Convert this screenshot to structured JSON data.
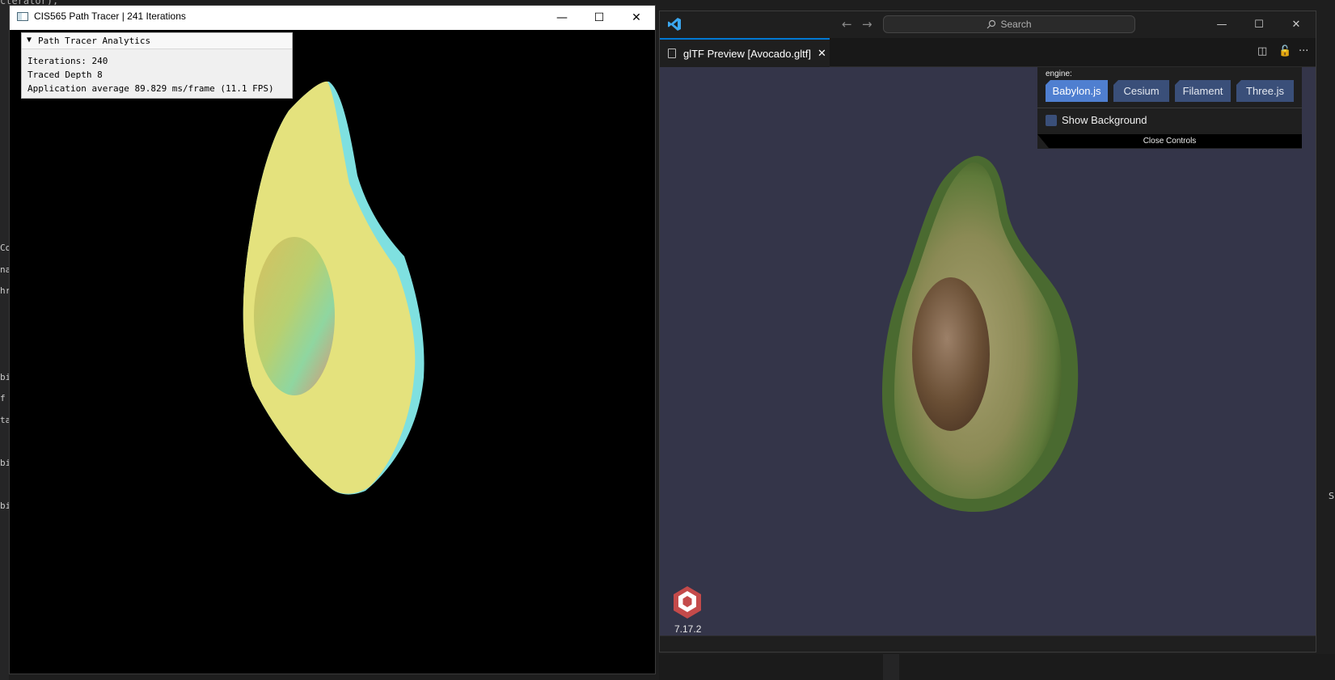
{
  "background_editor": {
    "top_line": "cterator);",
    "fragments": [
      "Co",
      "nal",
      "hr",
      "bi",
      "f",
      "ta",
      "bi",
      "bi"
    ],
    "right_fragment": "S"
  },
  "path_tracer": {
    "title": "CIS565 Path Tracer | 241 Iterations",
    "controls": {
      "minimize": "—",
      "maximize": "☐",
      "close": "✕"
    },
    "analytics": {
      "arrow": "▼",
      "title": "Path Tracer Analytics",
      "iterations": "Iterations: 240",
      "traced_depth": "Traced Depth 8",
      "average": "Application average 89.829 ms/frame (11.1 FPS)"
    }
  },
  "vscode": {
    "nav_back": "←",
    "nav_forward": "→",
    "search_placeholder": "Search",
    "controls": {
      "minimize": "—",
      "maximize": "☐",
      "close": "✕"
    },
    "tab": {
      "label": "glTF Preview [Avocado.gltf]",
      "close": "✕"
    },
    "tab_actions": {
      "split": "◫",
      "lock": "🔓",
      "more": "···"
    },
    "viewer": {
      "engine_label": "engine:",
      "engines": [
        "Babylon.js",
        "Cesium",
        "Filament",
        "Three.js"
      ],
      "selected_engine": "Babylon.js",
      "show_background_label": "Show Background",
      "close_controls_label": "Close Controls",
      "version": "7.17.2"
    }
  },
  "colors": {
    "vscode_accent": "#0078d4",
    "viewer_bg": "#343549",
    "engine_selected": "#4f7fd0",
    "engine_default": "#3a4f79",
    "babylon_logo": "#c44a4a"
  }
}
